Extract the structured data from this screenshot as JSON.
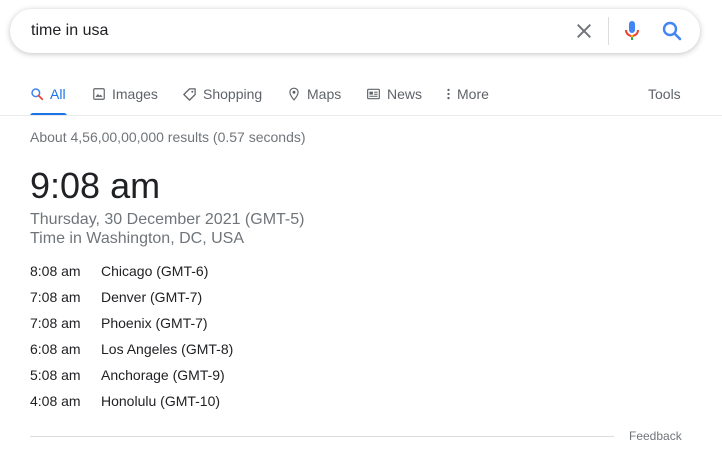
{
  "search": {
    "query": "time in usa",
    "icons": {
      "clear": "close-icon",
      "voice": "microphone-icon",
      "submit": "search-icon"
    }
  },
  "tabs": [
    {
      "label": "All",
      "icon": "search-icon",
      "active": true
    },
    {
      "label": "Images",
      "icon": "image-icon"
    },
    {
      "label": "Shopping",
      "icon": "tag-icon"
    },
    {
      "label": "Maps",
      "icon": "map-pin-icon"
    },
    {
      "label": "News",
      "icon": "newspaper-icon"
    },
    {
      "label": "More",
      "icon": "more-vertical-icon"
    }
  ],
  "tools_label": "Tools",
  "results_stats": "About 4,56,00,00,000 results (0.57 seconds)",
  "clock": {
    "time": "9:08 am",
    "date": "Thursday, 30 December 2021 (GMT-5)",
    "location": "Time in Washington, DC, USA"
  },
  "zones": [
    {
      "time": "8:08 am",
      "city": "Chicago (GMT-6)"
    },
    {
      "time": "7:08 am",
      "city": "Denver (GMT-7)"
    },
    {
      "time": "7:08 am",
      "city": "Phoenix (GMT-7)"
    },
    {
      "time": "6:08 am",
      "city": "Los Angeles (GMT-8)"
    },
    {
      "time": "5:08 am",
      "city": "Anchorage (GMT-9)"
    },
    {
      "time": "4:08 am",
      "city": "Honolulu (GMT-10)"
    }
  ],
  "feedback_label": "Feedback",
  "colors": {
    "accent": "#1a73e8",
    "muted": "#70757a",
    "text": "#202124"
  }
}
